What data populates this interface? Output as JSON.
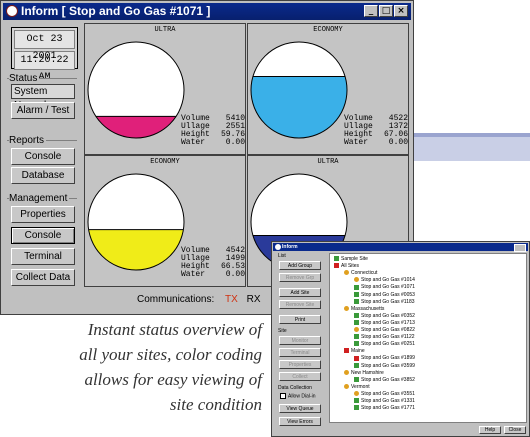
{
  "main_window": {
    "title": "Inform    [ Stop and Go Gas #1071 ]",
    "title_buttons": [
      "_",
      "□",
      "×"
    ],
    "date": "Oct 23 2001",
    "time": "11:20:22 AM",
    "status_label": "Status",
    "status_value": "System Normal",
    "alarm_test_label": "Alarm / Test",
    "reports_label": "Reports",
    "console_label": "Console",
    "database_label": "Database",
    "management_label": "Management",
    "properties_label": "Properties",
    "console2_label": "Console",
    "terminal_label": "Terminal",
    "collect_label": "Collect Data",
    "communications_label": "Communications:",
    "tx_label": "TX",
    "rx_label": "RX"
  },
  "tanks": [
    {
      "product": "ULTRA",
      "fill": 0.225,
      "color": "#e0207a",
      "volume": "5410",
      "ullage": "2551",
      "height": "59.76",
      "water": "0.00"
    },
    {
      "product": "ECONOMY",
      "fill": 0.64,
      "color": "#3ab0e8",
      "volume": "4522",
      "ullage": "1372",
      "height": "67.06",
      "water": "0.00"
    },
    {
      "product": "ECONOMY",
      "fill": 0.42,
      "color": "#f0ec18",
      "volume": "4542",
      "ullage": "1499",
      "height": "66.53",
      "water": "0.00"
    },
    {
      "product": "ULTRA",
      "fill": 0.36,
      "color": "#2a3a9a",
      "volume": "",
      "ullage": "",
      "height": "",
      "water": ""
    }
  ],
  "labels": {
    "volume": "Volume",
    "ullage": "Ullage",
    "height": "Height",
    "water": "Water"
  },
  "caption": [
    "Instant status overview of",
    "all your sites, color coding",
    "allows for easy viewing of",
    "site condition"
  ],
  "second_window": {
    "title": "Inform",
    "list_label": "List",
    "site_label": "Site",
    "data_collection_label": "Data Collection",
    "allow_dial_in": "Allow Dial-in",
    "buttons": [
      "Add Group",
      "Remove Grp",
      "Add Site",
      "Remove Site",
      "Print"
    ],
    "site_buttons": [
      "Monitor",
      "Terminal",
      "Properties",
      "Collect"
    ],
    "view_queue": "View Queue",
    "view_errors": "View Errors",
    "help": "Help",
    "close": "Close",
    "tree": [
      {
        "level": 0,
        "text": "Sample Site",
        "icon": "ok"
      },
      {
        "level": 0,
        "text": "All Sites",
        "icon": "alarm"
      },
      {
        "level": 1,
        "text": "Connecticut",
        "icon": "warn"
      },
      {
        "level": 2,
        "text": "Stop and Go Gas #1014",
        "icon": "warn"
      },
      {
        "level": 2,
        "text": "Stop and Go Gas #1071",
        "icon": "ok"
      },
      {
        "level": 2,
        "text": "Stop and Go Gas #0053",
        "icon": "ok"
      },
      {
        "level": 2,
        "text": "Stop and Go Gas #1183",
        "icon": "ok"
      },
      {
        "level": 1,
        "text": "Massachusetts",
        "icon": "warn"
      },
      {
        "level": 2,
        "text": "Stop and Go Gas #0352",
        "icon": "ok"
      },
      {
        "level": 2,
        "text": "Stop and Go Gas #1713",
        "icon": "ok"
      },
      {
        "level": 2,
        "text": "Stop and Go Gas #0822",
        "icon": "warn"
      },
      {
        "level": 2,
        "text": "Stop and Go Gas #1122",
        "icon": "ok"
      },
      {
        "level": 2,
        "text": "Stop and Go Gas #0251",
        "icon": "ok"
      },
      {
        "level": 1,
        "text": "Maine",
        "icon": "alarm"
      },
      {
        "level": 2,
        "text": "Stop and Go Gas #1899",
        "icon": "alarm"
      },
      {
        "level": 2,
        "text": "Stop and Go Gas #3599",
        "icon": "ok"
      },
      {
        "level": 1,
        "text": "New Hamshire",
        "icon": "warn"
      },
      {
        "level": 2,
        "text": "Stop and Go Gas #3852",
        "icon": "ok"
      },
      {
        "level": 1,
        "text": "Vermont",
        "icon": "warn"
      },
      {
        "level": 2,
        "text": "Stop and Go Gas #3551",
        "icon": "warn"
      },
      {
        "level": 2,
        "text": "Stop and Go Gas #1331",
        "icon": "ok"
      },
      {
        "level": 2,
        "text": "Stop and Go Gas #1771",
        "icon": "ok"
      }
    ]
  }
}
